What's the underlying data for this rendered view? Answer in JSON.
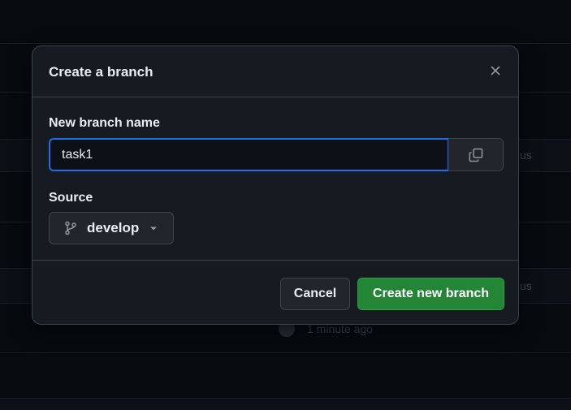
{
  "background": {
    "rows": [
      {
        "text": "us"
      },
      {
        "text": "us"
      },
      {
        "text": "1 minute ago"
      }
    ]
  },
  "dialog": {
    "title": "Create a branch",
    "close_icon": "close-icon",
    "branch_name": {
      "label": "New branch name",
      "value": "task1",
      "copy_icon": "copy-icon"
    },
    "source": {
      "label": "Source",
      "selected": "develop",
      "branch_icon": "git-branch-icon",
      "caret_icon": "triangle-down-icon"
    },
    "buttons": {
      "cancel": "Cancel",
      "create": "Create new branch"
    }
  },
  "colors": {
    "accent": "#1f6feb",
    "primary_button": "#238636",
    "surface": "#161b22",
    "page_bg": "#0d1117"
  }
}
